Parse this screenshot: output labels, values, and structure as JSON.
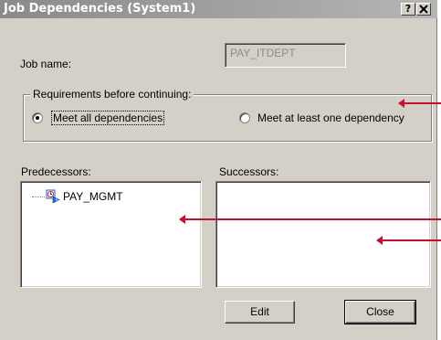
{
  "window": {
    "title": "Job Dependencies (System1)",
    "help_label": "?",
    "close_label": "✕"
  },
  "job_name": {
    "label": "Job name:",
    "value": "PAY_ITDEPT"
  },
  "requirements": {
    "legend": "Requirements before continuing:",
    "options": [
      {
        "label": "Meet all dependencies",
        "selected": true
      },
      {
        "label": "Meet at least one dependency",
        "selected": false
      }
    ]
  },
  "predecessors": {
    "label": "Predecessors:",
    "items": [
      {
        "label": "PAY_MGMT",
        "icon": "job-clock-icon"
      }
    ]
  },
  "successors": {
    "label": "Successors:",
    "items": []
  },
  "buttons": {
    "edit": "Edit",
    "close": "Close"
  },
  "colors": {
    "dialog_bg": "#d4d0c8",
    "annotation_arrow": "#c8102e",
    "disabled_text": "#8c8c8c"
  }
}
